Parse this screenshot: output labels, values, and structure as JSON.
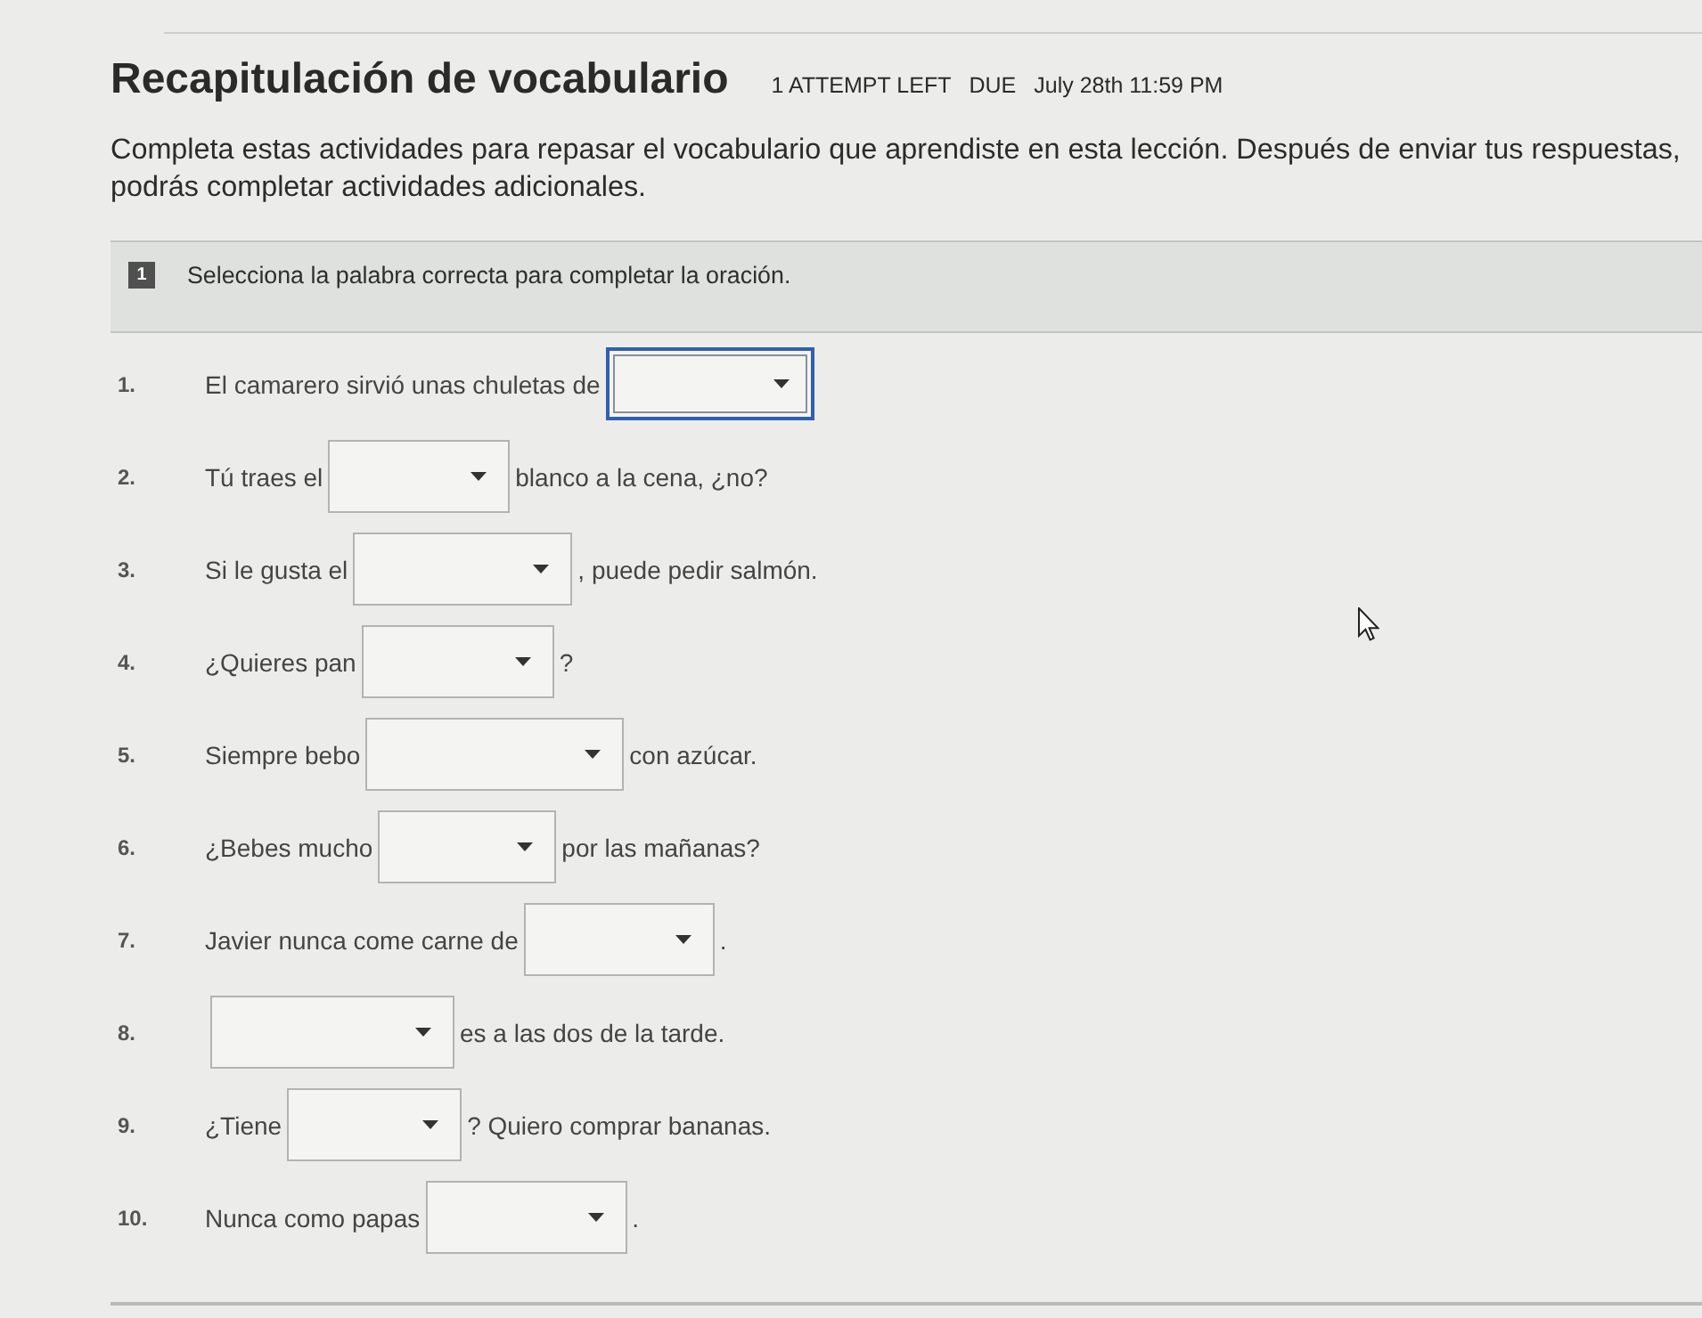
{
  "header": {
    "title": "Recapitulación de vocabulario",
    "attempts": "1 ATTEMPT LEFT",
    "due_label": "DUE",
    "due_date": "July 28th 11:59 PM"
  },
  "intro": "Completa estas actividades para repasar el vocabulario que aprendiste en esta lección. Después de enviar tus respuestas, podrás completar actividades adicionales.",
  "section": {
    "number": "1",
    "instruction": "Selecciona la palabra correcta para completar la oración."
  },
  "questions": [
    {
      "number": "1.",
      "before": "El camarero sirvió unas chuletas de",
      "focused": true
    },
    {
      "number": "2.",
      "before": "Tú traes el",
      "after": "blanco a la cena, ¿no?",
      "focused": false
    },
    {
      "number": "3.",
      "before": "Si le gusta el",
      "after": ", puede pedir salmón.",
      "focused": false
    },
    {
      "number": "4.",
      "before": "¿Quieres pan",
      "after": "?",
      "focused": false
    },
    {
      "number": "5.",
      "before": "Siempre bebo",
      "after": "con azúcar.",
      "focused": false
    },
    {
      "number": "6.",
      "before": "¿Bebes mucho",
      "after": "por las mañanas?",
      "focused": false
    },
    {
      "number": "7.",
      "before": "Javier nunca come carne de",
      "after": ".",
      "focused": false
    },
    {
      "number": "8.",
      "after": "es a las dos de la tarde.",
      "focused": false
    },
    {
      "number": "9.",
      "before": "¿Tiene",
      "after": "? Quiero comprar bananas.",
      "focused": false
    },
    {
      "number": "10.",
      "before": "Nunca como papas",
      "after": ".",
      "focused": false
    }
  ]
}
